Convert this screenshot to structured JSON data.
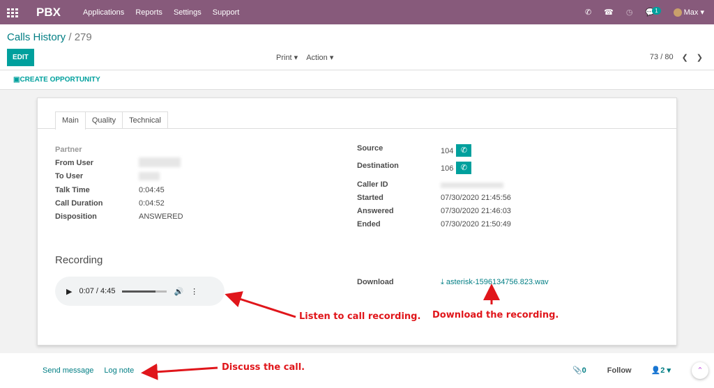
{
  "nav": {
    "brand": "PBX",
    "menu": [
      "Applications",
      "Reports",
      "Settings",
      "Support"
    ],
    "chat_count": "1",
    "user": "Max"
  },
  "breadcrumb": {
    "parent": "Calls History",
    "sep": "/",
    "id": "279"
  },
  "buttons": {
    "edit": "EDIT",
    "print": "Print",
    "action": "Action",
    "create_opportunity": "CREATE OPPORTUNITY"
  },
  "pager": {
    "value": "73 / 80"
  },
  "tabs": [
    "Main",
    "Quality",
    "Technical"
  ],
  "left_fields": [
    {
      "label": "Partner",
      "value": ""
    },
    {
      "label": "From User",
      "value": ""
    },
    {
      "label": "To User",
      "value": ""
    },
    {
      "label": "Talk Time",
      "value": "0:04:45"
    },
    {
      "label": "Call Duration",
      "value": "0:04:52"
    },
    {
      "label": "Disposition",
      "value": "ANSWERED"
    }
  ],
  "right_fields": [
    {
      "label": "Source",
      "value": "104"
    },
    {
      "label": "Destination",
      "value": "106"
    },
    {
      "label": "Caller ID",
      "value": ""
    },
    {
      "label": "Started",
      "value": "07/30/2020 21:45:56"
    },
    {
      "label": "Answered",
      "value": "07/30/2020 21:46:03"
    },
    {
      "label": "Ended",
      "value": "07/30/2020 21:50:49"
    }
  ],
  "recording": {
    "title": "Recording",
    "time": "0:07 / 4:45",
    "progress": 0.75,
    "download_label": "Download",
    "file": "asterisk-1596134756.823.wav"
  },
  "annotations": {
    "listen": "Listen to call recording.",
    "download": "Download the recording.",
    "discuss": "Discuss the call."
  },
  "chatter": {
    "send": "Send message",
    "log": "Log note",
    "attachments": "0",
    "follow": "Follow",
    "followers": "2"
  },
  "colors": {
    "nav": "#875A7B",
    "accent": "#00A09D",
    "annotation": "#e0161b"
  }
}
